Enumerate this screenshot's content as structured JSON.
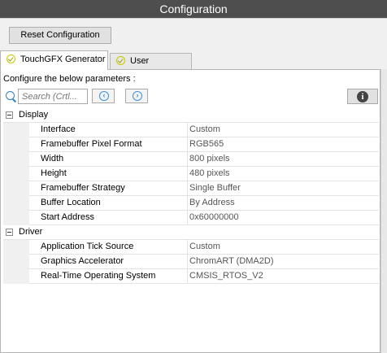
{
  "window": {
    "title": "Configuration"
  },
  "toolbar": {
    "reset_label": "Reset Configuration"
  },
  "tabs": [
    {
      "label": "TouchGFX Generator",
      "active": true,
      "icon": "check-circle-icon"
    },
    {
      "label": "User Constants",
      "active": false,
      "icon": "check-circle-icon"
    }
  ],
  "panel": {
    "configure_label": "Configure the below parameters :",
    "search": {
      "placeholder": "Search (Crtl...",
      "icon": "search-icon"
    },
    "nav_prev_icon": "chevron-left-icon",
    "nav_next_icon": "chevron-right-icon",
    "info_icon": "info-icon"
  },
  "groups": [
    {
      "name": "Display",
      "params": [
        {
          "name": "Interface",
          "value": "Custom"
        },
        {
          "name": "Framebuffer Pixel Format",
          "value": "RGB565"
        },
        {
          "name": "Width",
          "value": "800 pixels"
        },
        {
          "name": "Height",
          "value": "480 pixels"
        },
        {
          "name": "Framebuffer Strategy",
          "value": "Single Buffer"
        },
        {
          "name": "Buffer Location",
          "value": "By Address"
        },
        {
          "name": "Start Address",
          "value": "0x60000000"
        }
      ]
    },
    {
      "name": "Driver",
      "params": [
        {
          "name": "Application Tick Source",
          "value": "Custom"
        },
        {
          "name": "Graphics Accelerator",
          "value": "ChromART (DMA2D)"
        },
        {
          "name": "Real-Time Operating System",
          "value": "CMSIS_RTOS_V2"
        }
      ]
    }
  ],
  "colors": {
    "titlebar": "#4e4e4e",
    "accent": "#3a8fd6",
    "check": "#c8c800"
  }
}
